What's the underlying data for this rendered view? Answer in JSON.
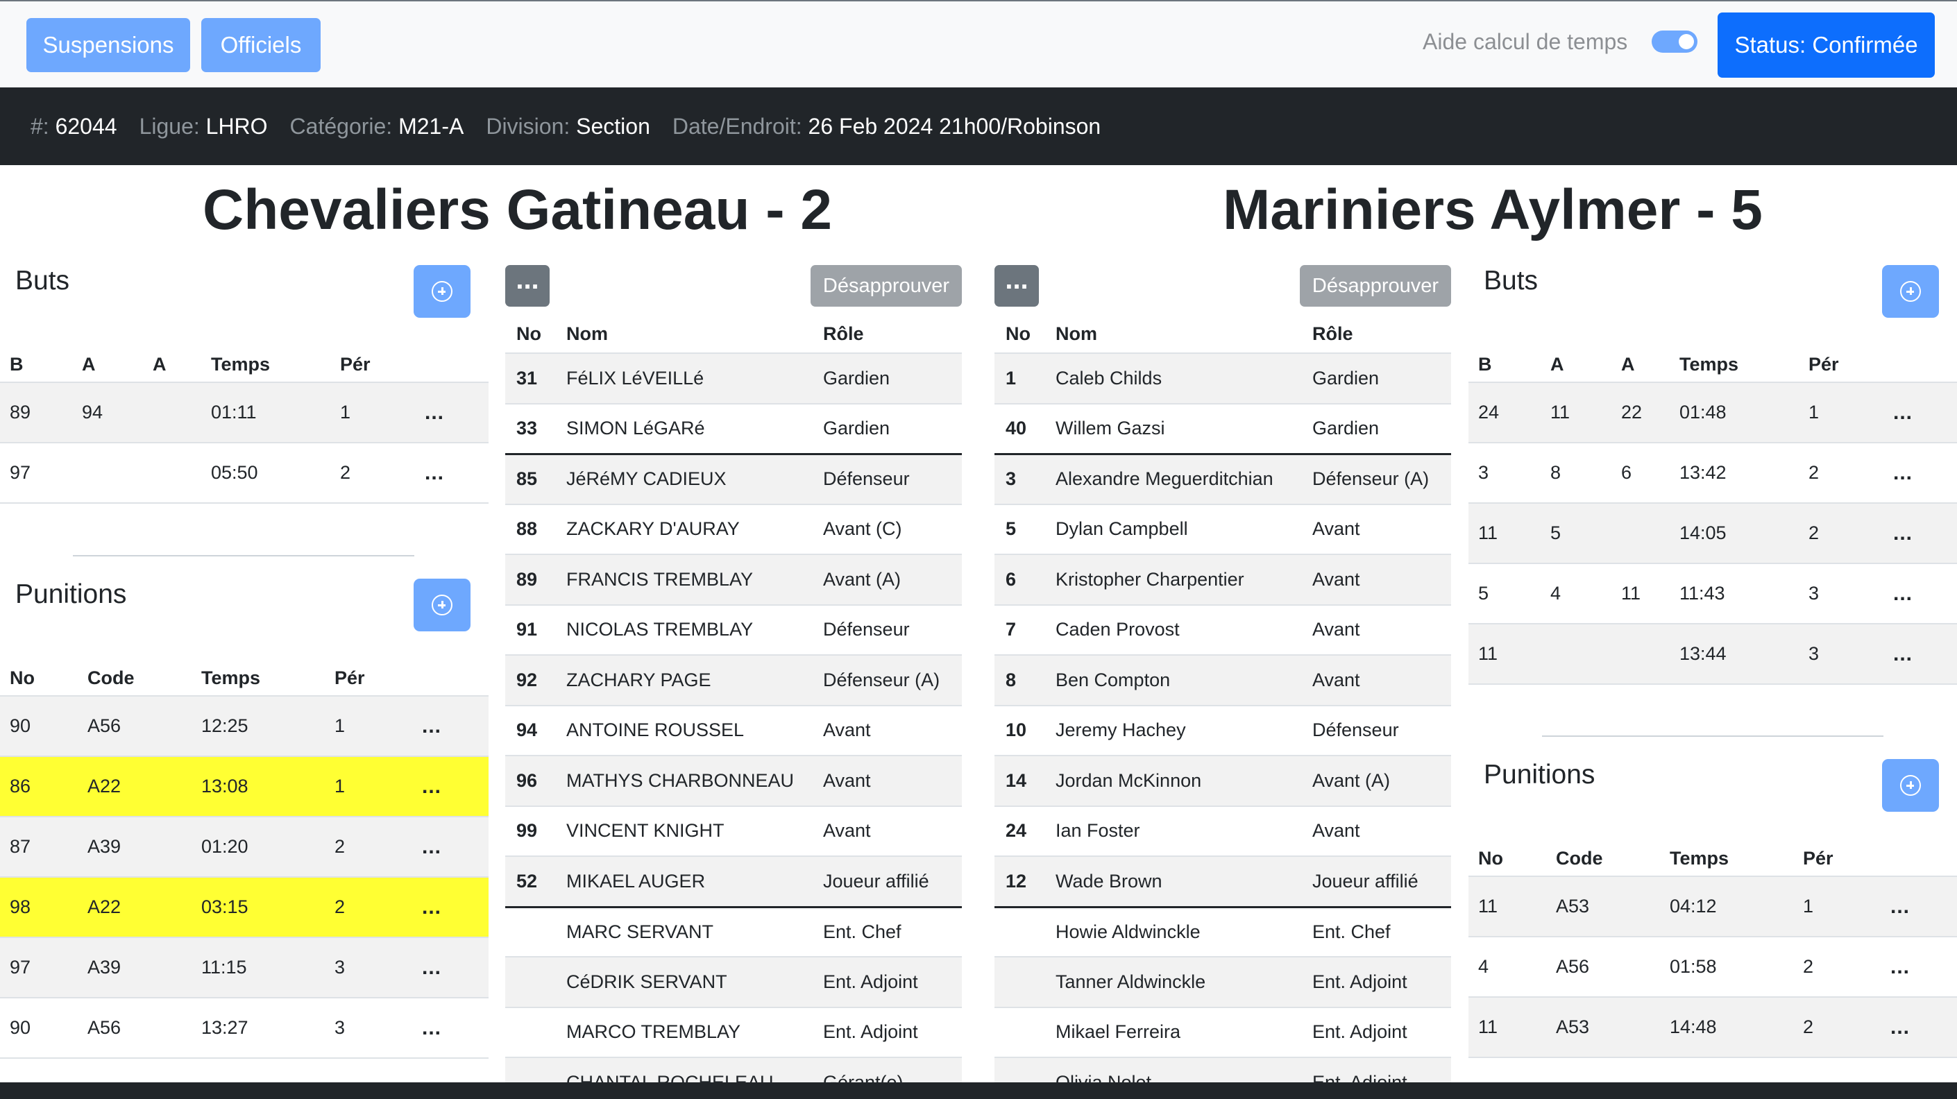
{
  "toolbar": {
    "suspensions_label": "Suspensions",
    "officiels_label": "Officiels",
    "aide_label": "Aide calcul de temps",
    "aide_enabled": true,
    "status_label": "Status: Confirmée"
  },
  "info": {
    "number_label": "#:",
    "number_value": "62044",
    "ligue_label": "Ligue:",
    "ligue_value": "LHRO",
    "categorie_label": "Catégorie:",
    "categorie_value": "M21-A",
    "division_label": "Division:",
    "division_value": "Section",
    "date_label": "Date/Endroit:",
    "date_value": "26 Feb 2024 21h00/Robinson"
  },
  "home": {
    "title": "Chevaliers Gatineau - 2",
    "buts_title": "Buts",
    "buts_headers": [
      "B",
      "A",
      "A",
      "Temps",
      "Pér"
    ],
    "buts": [
      {
        "b": "89",
        "a1": "94",
        "a2": "",
        "temps": "01:11",
        "per": "1"
      },
      {
        "b": "97",
        "a1": "",
        "a2": "",
        "temps": "05:50",
        "per": "2"
      }
    ],
    "punitions_title": "Punitions",
    "punitions_headers": [
      "No",
      "Code",
      "Temps",
      "Pér"
    ],
    "punitions": [
      {
        "no": "90",
        "code": "A56",
        "temps": "12:25",
        "per": "1",
        "highlight": false
      },
      {
        "no": "86",
        "code": "A22",
        "temps": "13:08",
        "per": "1",
        "highlight": true
      },
      {
        "no": "87",
        "code": "A39",
        "temps": "01:20",
        "per": "2",
        "highlight": false
      },
      {
        "no": "98",
        "code": "A22",
        "temps": "03:15",
        "per": "2",
        "highlight": true
      },
      {
        "no": "97",
        "code": "A39",
        "temps": "11:15",
        "per": "3",
        "highlight": false
      },
      {
        "no": "90",
        "code": "A56",
        "temps": "13:27",
        "per": "3",
        "highlight": false
      }
    ],
    "roster_more": "...",
    "roster_button": "Désapprouver",
    "roster_headers": [
      "No",
      "Nom",
      "Rôle"
    ],
    "roster": [
      {
        "no": "31",
        "nom": "FéLIX LéVEILLé",
        "role": "Gardien"
      },
      {
        "no": "33",
        "nom": "SIMON LéGARé",
        "role": "Gardien"
      },
      {
        "no": "85",
        "nom": "JéRéMY CADIEUX",
        "role": "Défenseur"
      },
      {
        "no": "88",
        "nom": "ZACKARY D'AURAY",
        "role": "Avant (C)"
      },
      {
        "no": "89",
        "nom": "FRANCIS TREMBLAY",
        "role": "Avant (A)"
      },
      {
        "no": "91",
        "nom": "NICOLAS TREMBLAY",
        "role": "Défenseur"
      },
      {
        "no": "92",
        "nom": "ZACHARY PAGE",
        "role": "Défenseur (A)"
      },
      {
        "no": "94",
        "nom": "ANTOINE ROUSSEL",
        "role": "Avant"
      },
      {
        "no": "96",
        "nom": "MATHYS CHARBONNEAU",
        "role": "Avant"
      },
      {
        "no": "99",
        "nom": "VINCENT KNIGHT",
        "role": "Avant"
      },
      {
        "no": "52",
        "nom": "MIKAEL AUGER",
        "role": "Joueur affilié"
      },
      {
        "no": "",
        "nom": "MARC SERVANT",
        "role": "Ent. Chef"
      },
      {
        "no": "",
        "nom": "CéDRIK SERVANT",
        "role": "Ent. Adjoint"
      },
      {
        "no": "",
        "nom": "MARCO TREMBLAY",
        "role": "Ent. Adjoint"
      },
      {
        "no": "",
        "nom": "CHANTAL ROCHELEAU",
        "role": "Gérant(e)"
      }
    ]
  },
  "away": {
    "title": "Mariniers Aylmer - 5",
    "buts_title": "Buts",
    "buts_headers": [
      "B",
      "A",
      "A",
      "Temps",
      "Pér"
    ],
    "buts": [
      {
        "b": "24",
        "a1": "11",
        "a2": "22",
        "temps": "01:48",
        "per": "1"
      },
      {
        "b": "3",
        "a1": "8",
        "a2": "6",
        "temps": "13:42",
        "per": "2"
      },
      {
        "b": "11",
        "a1": "5",
        "a2": "",
        "temps": "14:05",
        "per": "2"
      },
      {
        "b": "5",
        "a1": "4",
        "a2": "11",
        "temps": "11:43",
        "per": "3"
      },
      {
        "b": "11",
        "a1": "",
        "a2": "",
        "temps": "13:44",
        "per": "3"
      }
    ],
    "punitions_title": "Punitions",
    "punitions_headers": [
      "No",
      "Code",
      "Temps",
      "Pér"
    ],
    "punitions": [
      {
        "no": "11",
        "code": "A53",
        "temps": "04:12",
        "per": "1",
        "highlight": false
      },
      {
        "no": "4",
        "code": "A56",
        "temps": "01:58",
        "per": "2",
        "highlight": false
      },
      {
        "no": "11",
        "code": "A53",
        "temps": "14:48",
        "per": "2",
        "highlight": false
      }
    ],
    "roster_more": "...",
    "roster_button": "Désapprouver",
    "roster_headers": [
      "No",
      "Nom",
      "Rôle"
    ],
    "roster": [
      {
        "no": "1",
        "nom": "Caleb Childs",
        "role": "Gardien"
      },
      {
        "no": "40",
        "nom": "Willem Gazsi",
        "role": "Gardien"
      },
      {
        "no": "3",
        "nom": "Alexandre Meguerditchian",
        "role": "Défenseur (A)"
      },
      {
        "no": "5",
        "nom": "Dylan Campbell",
        "role": "Avant"
      },
      {
        "no": "6",
        "nom": "Kristopher Charpentier",
        "role": "Avant"
      },
      {
        "no": "7",
        "nom": "Caden Provost",
        "role": "Avant"
      },
      {
        "no": "8",
        "nom": "Ben Compton",
        "role": "Avant"
      },
      {
        "no": "10",
        "nom": "Jeremy Hachey",
        "role": "Défenseur"
      },
      {
        "no": "14",
        "nom": "Jordan McKinnon",
        "role": "Avant (A)"
      },
      {
        "no": "24",
        "nom": "Ian Foster",
        "role": "Avant"
      },
      {
        "no": "12",
        "nom": "Wade Brown",
        "role": "Joueur affilié"
      },
      {
        "no": "",
        "nom": "Howie Aldwinckle",
        "role": "Ent. Chef"
      },
      {
        "no": "",
        "nom": "Tanner Aldwinckle",
        "role": "Ent. Adjoint"
      },
      {
        "no": "",
        "nom": "Mikael Ferreira",
        "role": "Ent. Adjoint"
      },
      {
        "no": "",
        "nom": "Olivia Nolet",
        "role": "Ent. Adjoint"
      }
    ]
  },
  "row_menu": "...",
  "colors": {
    "accent": "#0d6efd",
    "accent_light": "#6ea8fe",
    "dark": "#212529",
    "highlight": "#ffff33"
  }
}
